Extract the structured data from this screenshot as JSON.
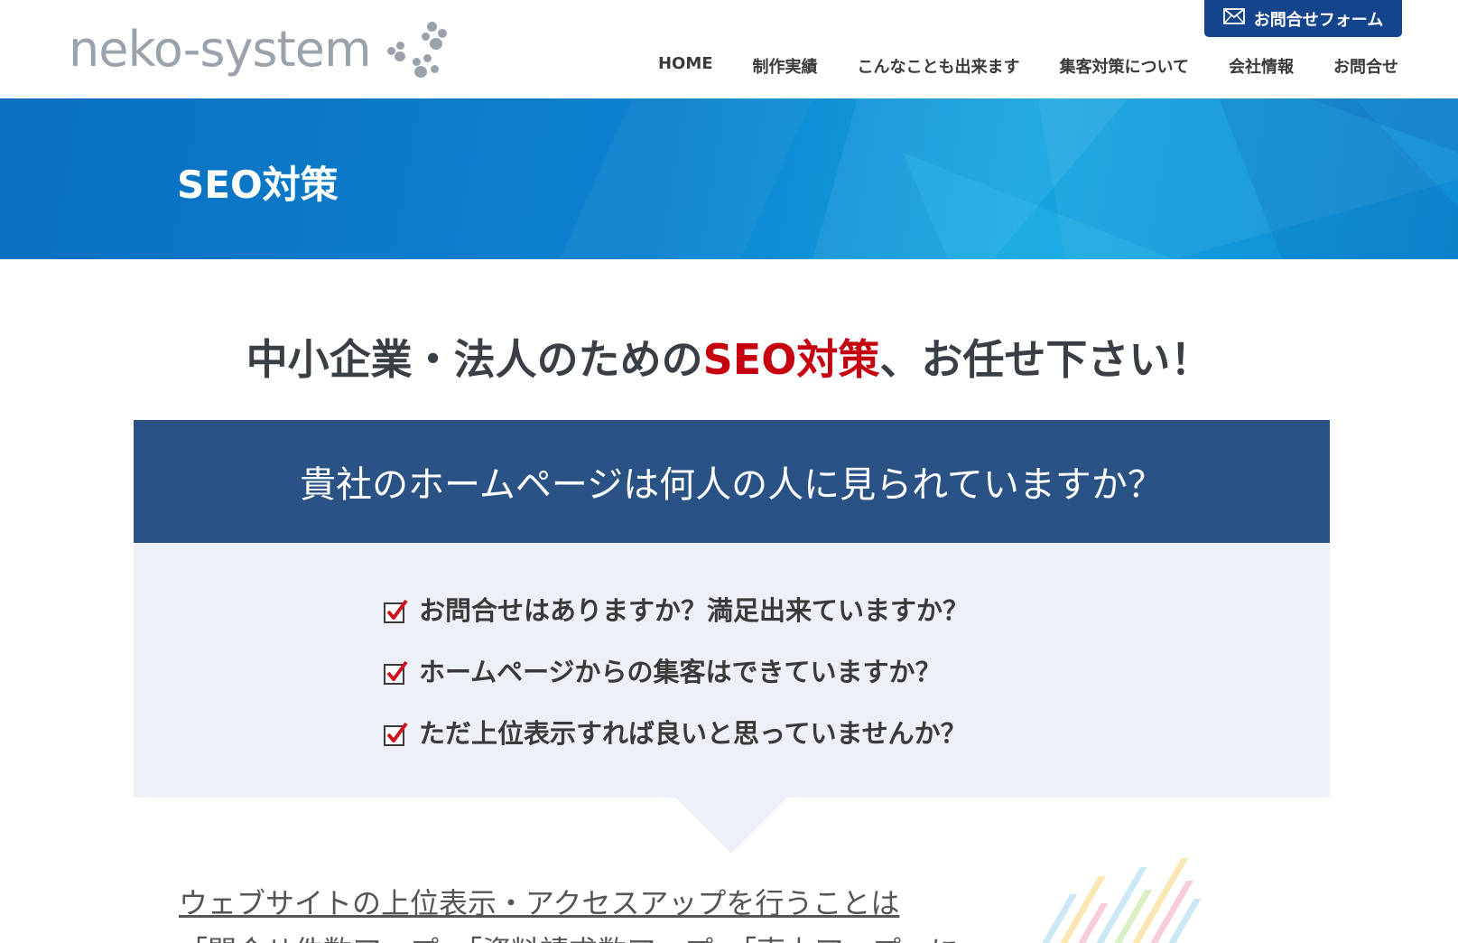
{
  "header": {
    "logo_text": "neko-system",
    "contact_button_label": "お問合せフォーム",
    "nav": [
      "HOME",
      "制作実績",
      "こんなことも出来ます",
      "集客対策について",
      "会社情報",
      "お問合せ"
    ]
  },
  "hero": {
    "title": "SEO対策"
  },
  "main": {
    "heading_prefix": "中小企業・法人のための",
    "heading_accent": "SEO対策",
    "heading_suffix": "、お任せ下さい！",
    "question": "貴社のホームページは何人の人に見られていますか？",
    "checklist": [
      "お問合せはありますか？満足出来ていますか？",
      "ホームページからの集客はできていますか？",
      "ただ上位表示すれば良いと思っていませんか？"
    ],
    "subtext": "ウェブサイトの上位表示・アクセスアップを行うことは",
    "subtext2": "「問合せ件数アップ」「資料請求数アップ」「売上アップ」に"
  },
  "colors": {
    "accent_red": "#c5000f",
    "navy": "#2a5284",
    "button_blue": "#14458c",
    "light_panel": "#edf1f7"
  },
  "icons": [
    "paw-icon",
    "mail-icon",
    "checkbox-icon"
  ]
}
